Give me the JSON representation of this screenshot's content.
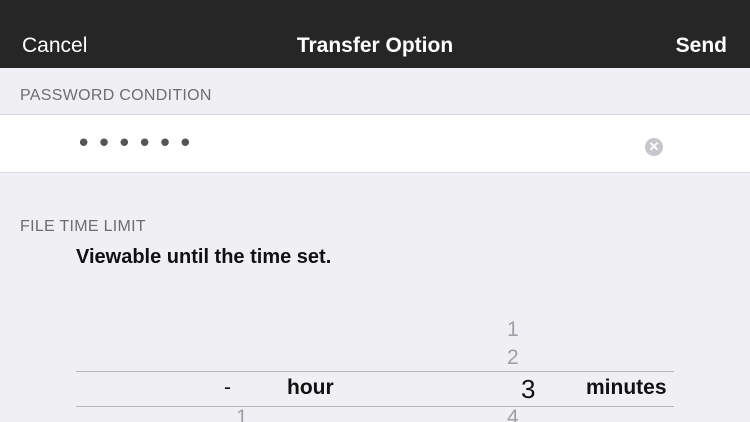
{
  "navbar": {
    "cancel_label": "Cancel",
    "title": "Transfer Option",
    "send_label": "Send"
  },
  "password": {
    "header": "PASSWORD CONDITION",
    "value": "••••••",
    "clear_icon": "clear-circle-icon"
  },
  "time_limit": {
    "header": "FILE TIME LIMIT",
    "description": "Viewable until the time set."
  },
  "picker": {
    "hour": {
      "selected": "-",
      "below": "1",
      "label": "hour"
    },
    "minutes": {
      "above_top": "-",
      "above": [
        "1",
        "2"
      ],
      "selected": "3",
      "below": "4",
      "label": "minutes"
    }
  },
  "colors": {
    "navbar_bg": "#262626",
    "page_bg": "#efeff4"
  }
}
